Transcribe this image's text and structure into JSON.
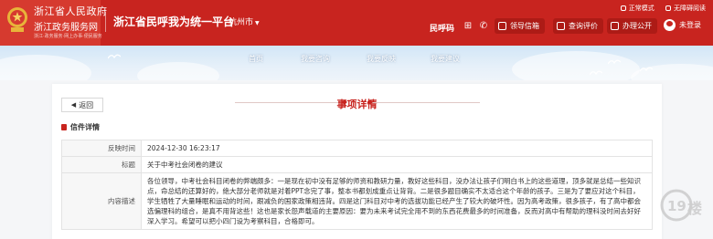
{
  "header": {
    "gov_name": "浙江省人民政府",
    "gov_service": "浙江政务服务网",
    "gov_sub": "浙江·政务服务·网上办事·便民服务",
    "platform_title": "浙江省民呼我为统一平台",
    "city": "杭州市",
    "top_links": [
      "正常模式",
      "无障碍阅读"
    ],
    "hotline_label": "民呼码",
    "buttons": [
      "领导信箱",
      "查询评价",
      "办理公开"
    ],
    "login_label": "未登录"
  },
  "nav": {
    "items": [
      "首页",
      "我要咨询",
      "我要反映",
      "我要建议"
    ]
  },
  "detail": {
    "back_label": "返回",
    "section_title": "事项详情",
    "letter_header": "信件详情",
    "rows": [
      {
        "key": "反映时间",
        "value": "2024-12-30 16:23:17"
      },
      {
        "key": "标题",
        "value": "关于中考社会闭卷的建议"
      },
      {
        "key": "内容描述",
        "value": "各位领导，中考社会科目闭卷的弊端颇多：一是现在初中没有足够的师资和教研力量，教好这些科目，没办法让孩子们明白书上的这些道理，顶多就是总结一些知识点，命总结的还算好的，绝大部分老师就是对着PPT念完了事，整本书都划成重点让背背。二是很多题目确实不太适合这个年龄的孩子。三是为了要应对这个科目，学生牺牲了大量睡眠和运动的时间，跟减负的国家政策相违背。四是这门科目对中考的选拔功能已经产生了较大的破坏性。因为高考政策，很多孩子，有了高中都会选偏理科的组合，是真不用背这些！这也是家长怨声载道的主要原因：要为未来考试完全用不到的东西花费最多的时间准备，反而对高中有帮助的理科没时间去好好深入学习。希望可以把小四门设为考察科目，合格即可。"
      }
    ]
  },
  "colors": {
    "brand_red": "#c8241f",
    "button_red": "#ad1b16",
    "banner_blue": "#d2e6f7"
  },
  "watermark_text": "19楼"
}
